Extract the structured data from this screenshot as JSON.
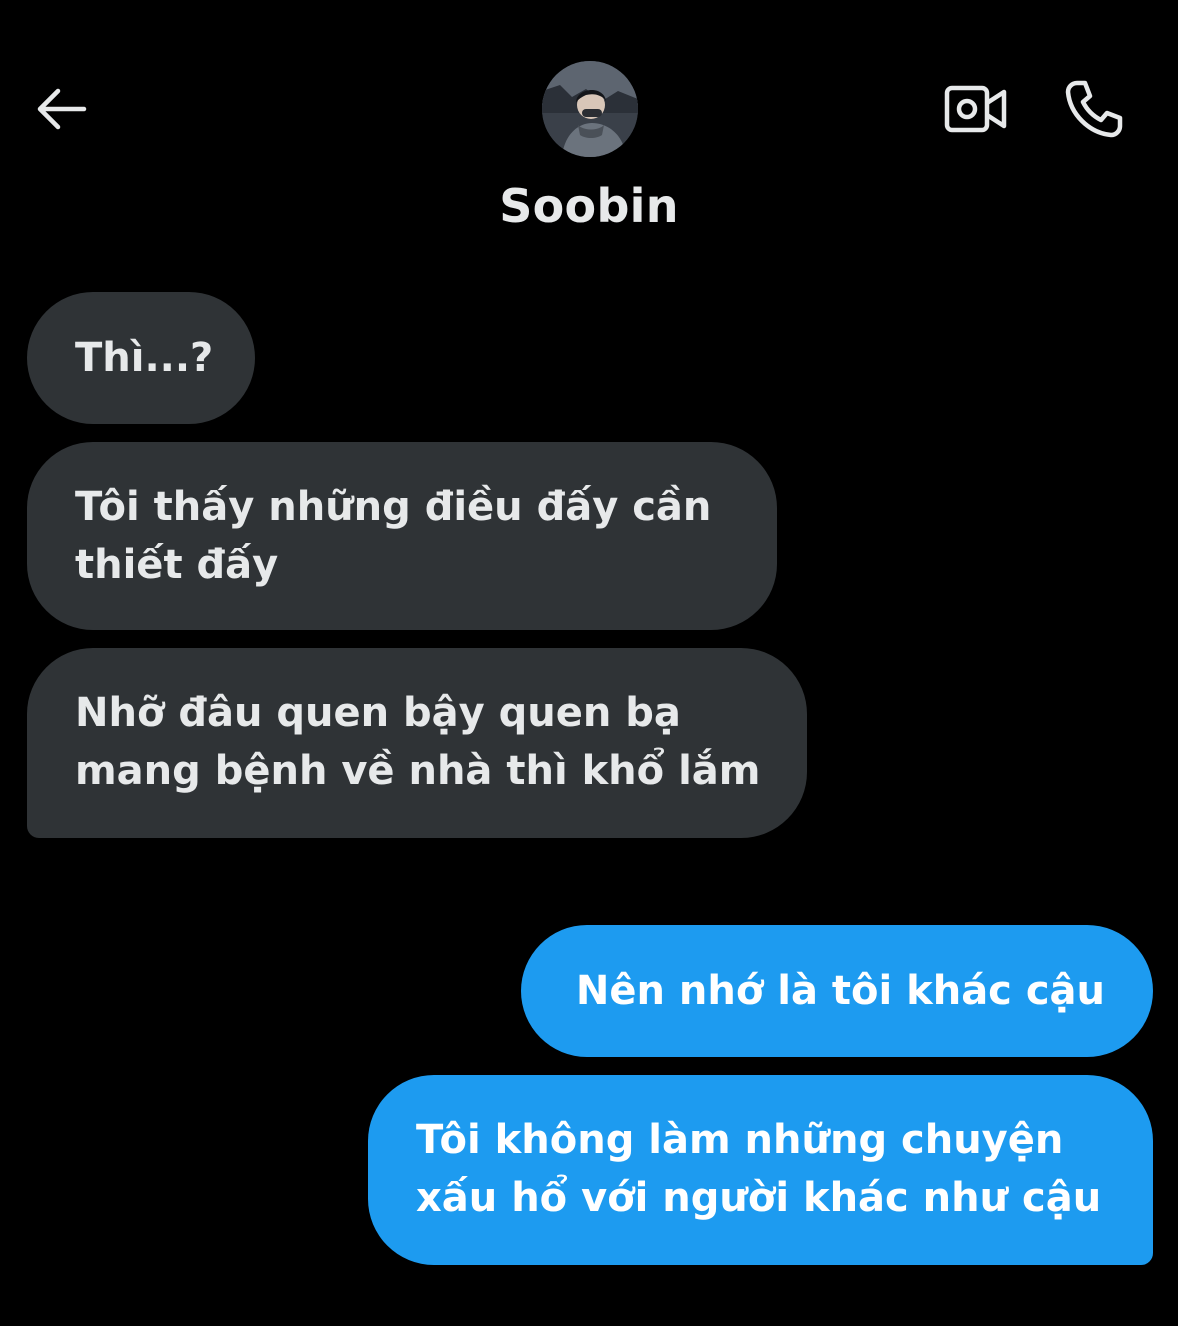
{
  "header": {
    "contact_name": "Soobin",
    "icons": {
      "back": "arrow-left-icon",
      "video": "video-camera-icon",
      "call": "phone-icon"
    }
  },
  "messages": [
    {
      "direction": "incoming",
      "lines": [
        "Thì...?"
      ]
    },
    {
      "direction": "incoming",
      "lines": [
        "Tôi thấy những điều đấy cần",
        "thiết đấy"
      ]
    },
    {
      "direction": "incoming",
      "lines": [
        "Nhỡ đâu quen bậy quen bạ",
        "mang bệnh về nhà thì khổ lắm"
      ]
    },
    {
      "direction": "outgoing",
      "lines": [
        "Nên nhớ là tôi khác cậu"
      ]
    },
    {
      "direction": "outgoing",
      "lines": [
        "Tôi không làm những chuyện",
        "xấu hổ với người khác như cậu"
      ]
    }
  ],
  "colors": {
    "background": "#000000",
    "incoming_bubble": "#2f3336",
    "outgoing_bubble": "#1d9bf0",
    "text_primary": "#e7e9ea"
  }
}
